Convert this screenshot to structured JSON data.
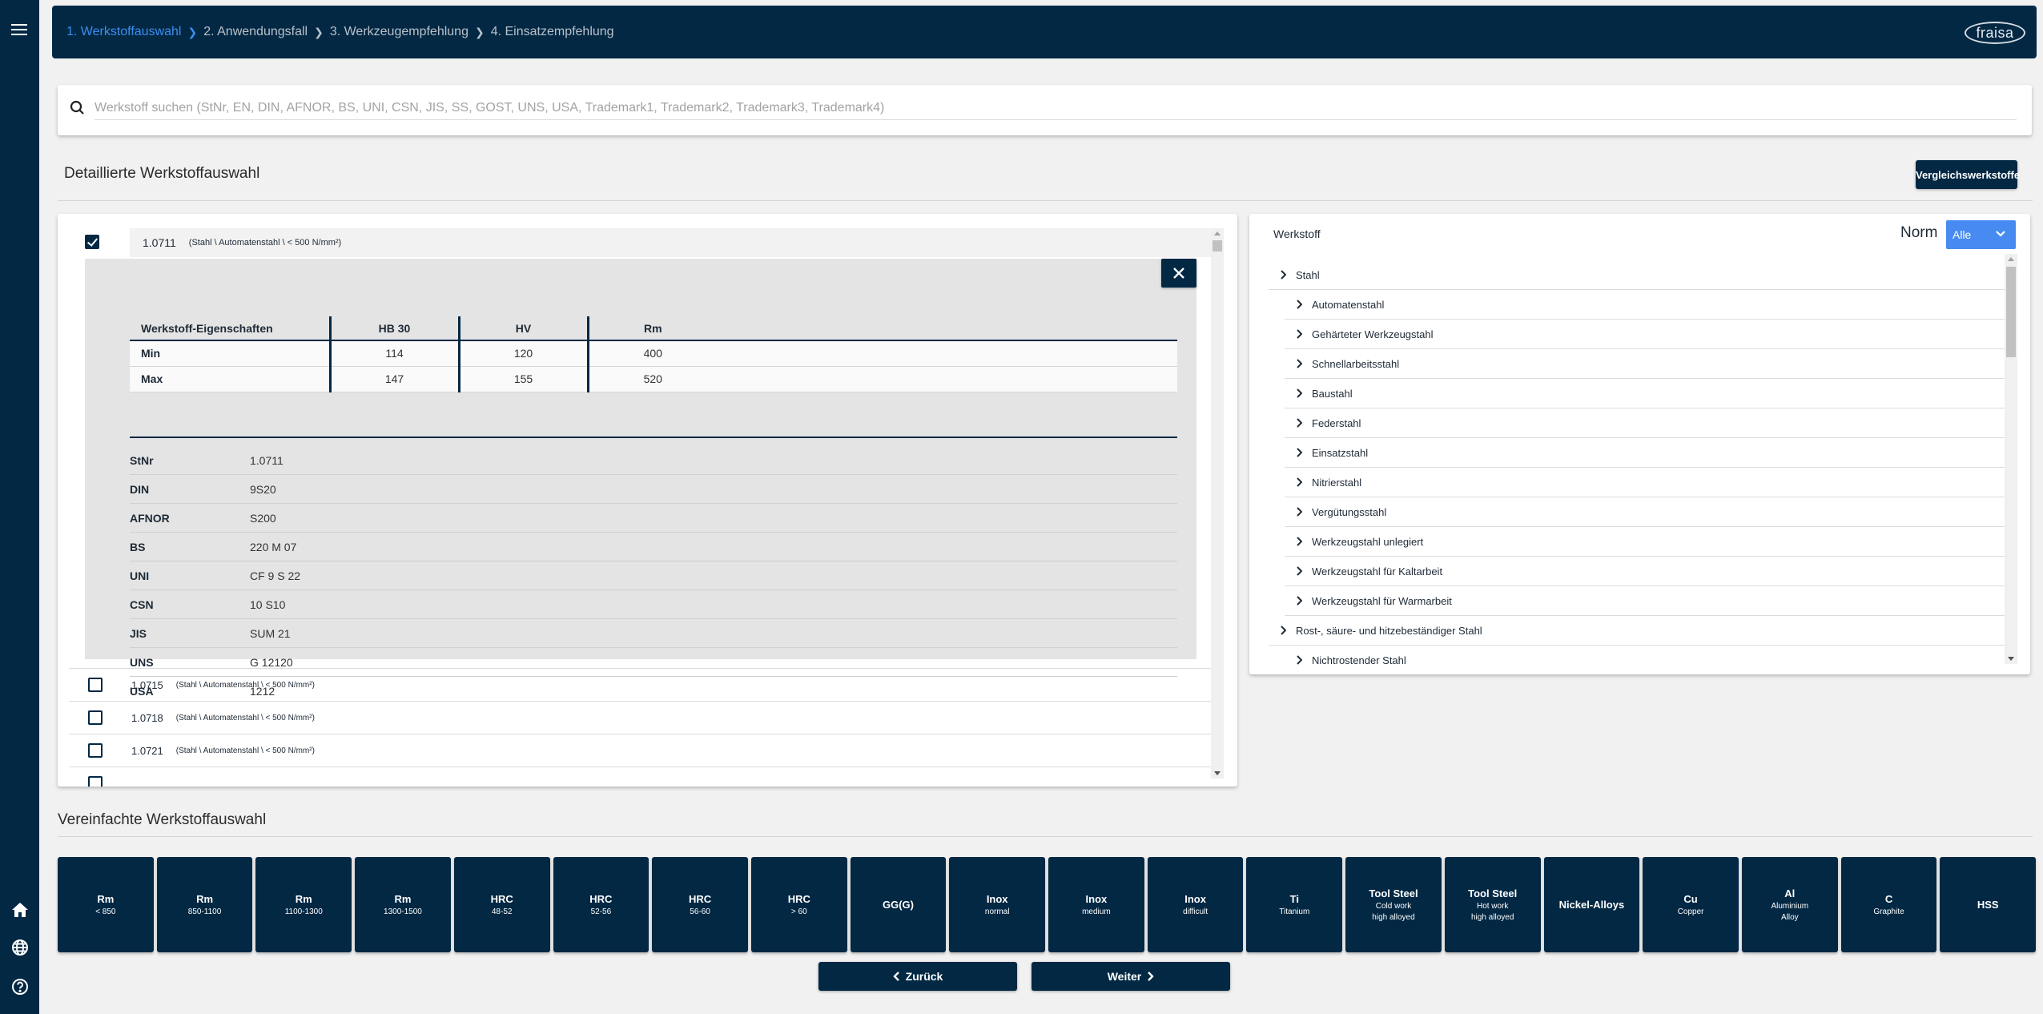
{
  "sidebar": {
    "icons": [
      "menu-icon",
      "home-icon",
      "globe-icon",
      "help-icon"
    ]
  },
  "header": {
    "breadcrumbs": [
      {
        "label": "1. Werkstoffauswahl",
        "active": true
      },
      {
        "label": "2. Anwendungsfall",
        "active": false
      },
      {
        "label": "3. Werkzeugempfehlung",
        "active": false
      },
      {
        "label": "4. Einsatzempfehlung",
        "active": false
      }
    ],
    "logo": "fraisa"
  },
  "search": {
    "placeholder": "Werkstoff suchen (StNr, EN, DIN, AFNOR, BS, UNI, CSN, JIS, SS, GOST, UNS, USA, Trademark1, Trademark2, Trademark3, Trademark4)",
    "value": ""
  },
  "detailed": {
    "title": "Detaillierte Werkstoffauswahl",
    "compare_button": "Vergleichswerkstoffe",
    "selected": {
      "code": "1.0711",
      "path": "(Stahl \\ Automatenstahl \\ < 500 N/mm²)",
      "checked": true,
      "close_label": "✕",
      "properties": {
        "headers": [
          "Werkstoff-Eigenschaften",
          "HB 30",
          "HV",
          "Rm"
        ],
        "rows": [
          [
            "Min",
            "114",
            "120",
            "400"
          ],
          [
            "Max",
            "147",
            "155",
            "520"
          ]
        ]
      },
      "norms": [
        {
          "key": "StNr",
          "value": "1.0711"
        },
        {
          "key": "DIN",
          "value": "9S20"
        },
        {
          "key": "AFNOR",
          "value": "S200"
        },
        {
          "key": "BS",
          "value": "220 M 07"
        },
        {
          "key": "UNI",
          "value": "CF 9 S 22"
        },
        {
          "key": "CSN",
          "value": "10 S10"
        },
        {
          "key": "JIS",
          "value": "SUM 21"
        },
        {
          "key": "UNS",
          "value": "G 12120"
        },
        {
          "key": "USA",
          "value": "1212"
        }
      ]
    },
    "materials": [
      {
        "code": "1.0715",
        "path": "(Stahl \\ Automatenstahl \\ < 500 N/mm²)",
        "checked": false
      },
      {
        "code": "1.0718",
        "path": "(Stahl \\ Automatenstahl \\ < 500 N/mm²)",
        "checked": false
      },
      {
        "code": "1.0721",
        "path": "(Stahl \\ Automatenstahl \\ < 500 N/mm²)",
        "checked": false
      }
    ]
  },
  "tree_panel": {
    "title": "Werkstoff",
    "norm_label": "Norm",
    "norm_selected": "Alle",
    "items": [
      {
        "label": "Stahl",
        "level": 0
      },
      {
        "label": "Automatenstahl",
        "level": 1
      },
      {
        "label": "Gehärteter Werkzeugstahl",
        "level": 1
      },
      {
        "label": "Schnellarbeitsstahl",
        "level": 1
      },
      {
        "label": "Baustahl",
        "level": 1
      },
      {
        "label": "Federstahl",
        "level": 1
      },
      {
        "label": "Einsatzstahl",
        "level": 1
      },
      {
        "label": "Nitrierstahl",
        "level": 1
      },
      {
        "label": "Vergütungsstahl",
        "level": 1
      },
      {
        "label": "Werkzeugstahl unlegiert",
        "level": 1
      },
      {
        "label": "Werkzeugstahl für Kaltarbeit",
        "level": 1
      },
      {
        "label": "Werkzeugstahl für Warmarbeit",
        "level": 1
      },
      {
        "label": "Rost-, säure- und hitzebeständiger Stahl",
        "level": 0
      },
      {
        "label": "Nichtrostender Stahl",
        "level": 1
      }
    ]
  },
  "simplified": {
    "title": "Vereinfachte Werkstoffauswahl",
    "tiles": [
      {
        "main": "Rm",
        "sub": [
          "< 850"
        ]
      },
      {
        "main": "Rm",
        "sub": [
          "850-1100"
        ]
      },
      {
        "main": "Rm",
        "sub": [
          "1100-1300"
        ]
      },
      {
        "main": "Rm",
        "sub": [
          "1300-1500"
        ]
      },
      {
        "main": "HRC",
        "sub": [
          "48-52"
        ]
      },
      {
        "main": "HRC",
        "sub": [
          "52-56"
        ]
      },
      {
        "main": "HRC",
        "sub": [
          "56-60"
        ]
      },
      {
        "main": "HRC",
        "sub": [
          "> 60"
        ]
      },
      {
        "main": "GG(G)",
        "sub": []
      },
      {
        "main": "Inox",
        "sub": [
          "normal"
        ]
      },
      {
        "main": "Inox",
        "sub": [
          "medium"
        ]
      },
      {
        "main": "Inox",
        "sub": [
          "difficult"
        ]
      },
      {
        "main": "Ti",
        "sub": [
          "Titanium"
        ]
      },
      {
        "main": "Tool Steel",
        "sub": [
          "Cold work",
          "high alloyed"
        ]
      },
      {
        "main": "Tool Steel",
        "sub": [
          "Hot work",
          "high alloyed"
        ]
      },
      {
        "main": "Nickel-Alloys",
        "sub": []
      },
      {
        "main": "Cu",
        "sub": [
          "Copper"
        ]
      },
      {
        "main": "Al",
        "sub": [
          "Aluminium",
          "Alloy"
        ]
      },
      {
        "main": "C",
        "sub": [
          "Graphite"
        ]
      },
      {
        "main": "HSS",
        "sub": []
      }
    ]
  },
  "navigation": {
    "back": "Zurück",
    "next": "Weiter"
  },
  "colors": {
    "brand_navy": "#022844",
    "accent_blue": "#3d8ef0",
    "select_blue": "#478bf2"
  }
}
